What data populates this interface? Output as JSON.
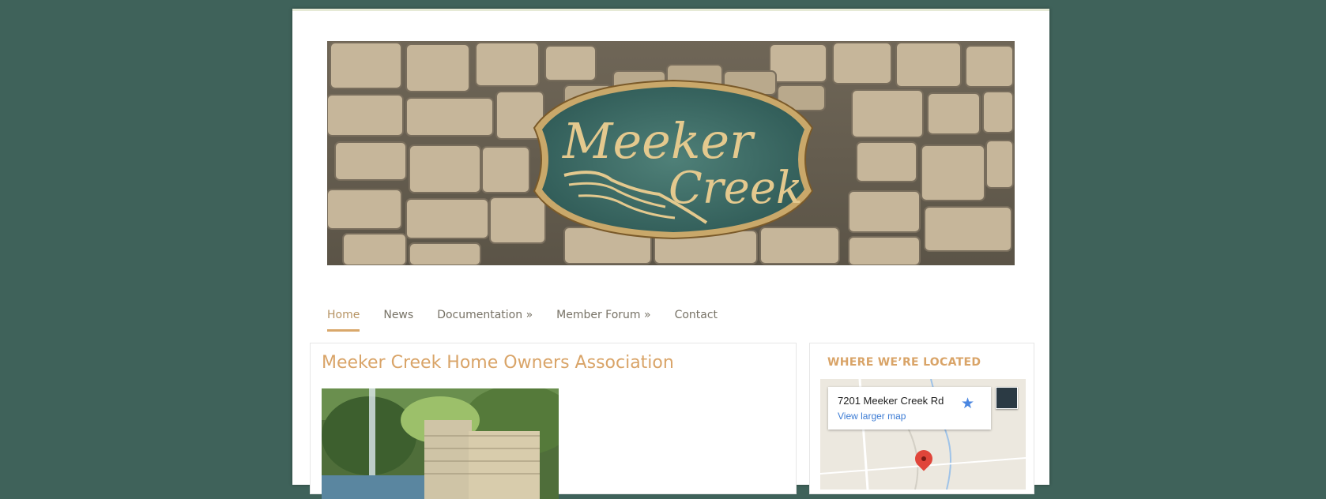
{
  "header": {
    "banner_image": "meeker-creek-stone-sign",
    "sign_text_line1": "Meeker",
    "sign_text_line2": "Creek"
  },
  "nav": {
    "items": [
      {
        "label": "Home",
        "active": true
      },
      {
        "label": "News",
        "active": false
      },
      {
        "label": "Documentation »",
        "active": false
      },
      {
        "label": "Member Forum »",
        "active": false
      },
      {
        "label": "Contact",
        "active": false
      }
    ]
  },
  "main": {
    "title": "Meeker Creek Home Owners Association",
    "image": "fountain-stone-entrance-photo"
  },
  "sidebar": {
    "title": "WHERE WE’RE LOCATED",
    "map": {
      "address": "7201 Meeker Creek Rd",
      "link": "View larger map",
      "star_icon": "star-icon"
    }
  },
  "colors": {
    "background": "#3f625a",
    "accent": "#d9a468",
    "nav_text": "#777266",
    "link": "#3b7bd4"
  }
}
